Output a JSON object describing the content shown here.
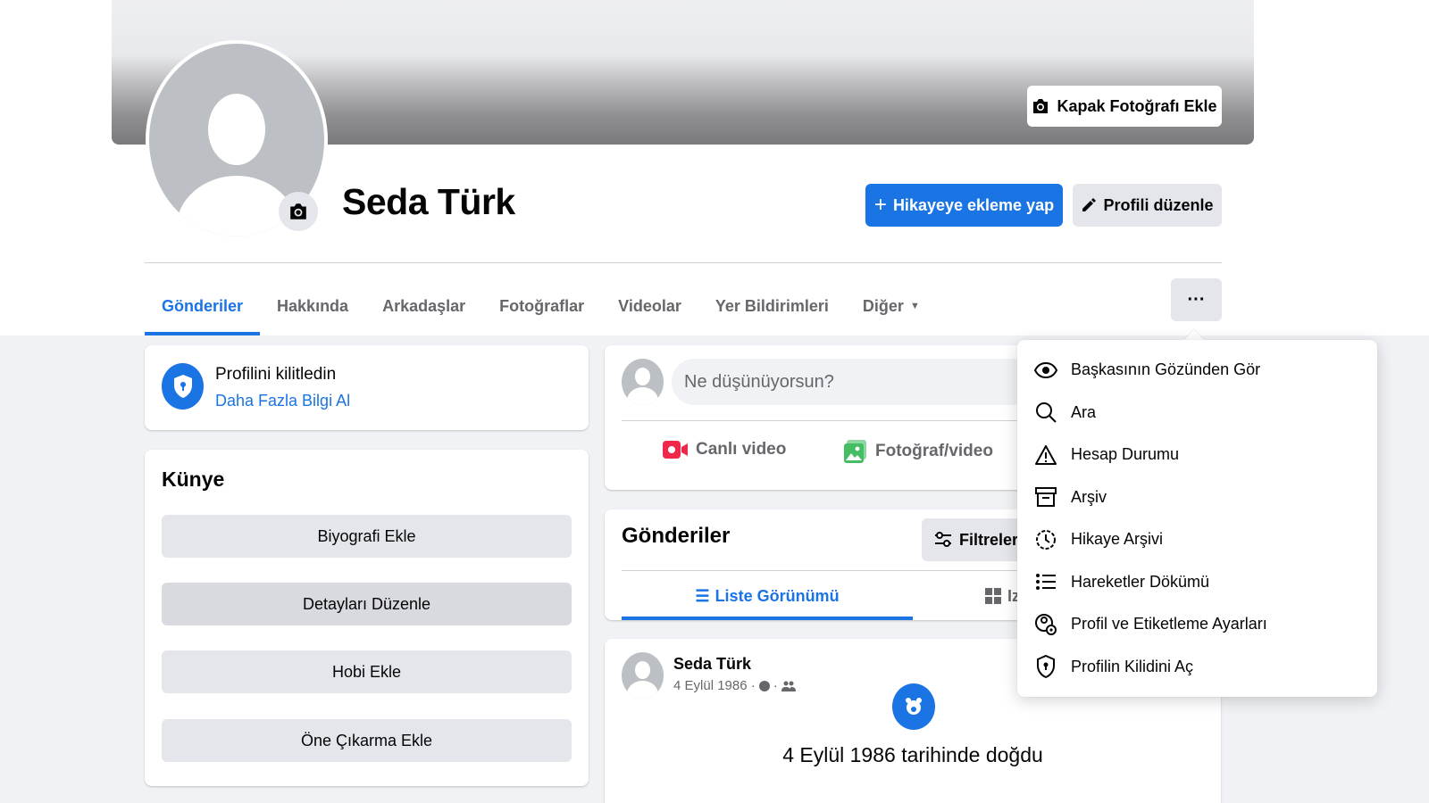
{
  "header": {
    "cover_button_label": "Kapak Fotoğrafı Ekle",
    "profile_name": "Seda Türk",
    "add_story_label": "Hikayeye ekleme yap",
    "edit_profile_label": "Profili düzenle"
  },
  "tabs": [
    {
      "label": "Gönderiler",
      "active": true
    },
    {
      "label": "Hakkında"
    },
    {
      "label": "Arkadaşlar"
    },
    {
      "label": "Fotoğraflar"
    },
    {
      "label": "Videolar"
    },
    {
      "label": "Yer Bildirimleri"
    },
    {
      "label": "Diğer"
    }
  ],
  "more_button_label": "···",
  "lock_card": {
    "title": "Profilini kilitledin",
    "link": "Daha Fazla Bilgi Al"
  },
  "intro": {
    "title": "Künye",
    "buttons": [
      "Biyografi Ekle",
      "Detayları Düzenle",
      "Hobi Ekle",
      "Öne Çıkarma Ekle"
    ]
  },
  "composer": {
    "placeholder": "Ne düşünüyorsun?",
    "live_video": "Canlı video",
    "photo_video": "Fotoğraf/video"
  },
  "posts": {
    "title": "Gönderiler",
    "filters_label": "Filtreler",
    "list_view_label": "Liste Görünümü",
    "grid_view_label": "Iz"
  },
  "post": {
    "author": "Seda Türk",
    "date": "4 Eylül 1986 ·",
    "text": "4 Eylül 1986 tarihinde doğdu"
  },
  "menu": {
    "items": [
      {
        "label": "Başkasının Gözünden Gör",
        "icon": "eye-icon"
      },
      {
        "label": "Ara",
        "icon": "search-icon"
      },
      {
        "label": "Hesap Durumu",
        "icon": "warning-icon"
      },
      {
        "label": "Arşiv",
        "icon": "archive-icon"
      },
      {
        "label": "Hikaye Arşivi",
        "icon": "story-archive-icon"
      },
      {
        "label": "Hareketler Dökümü",
        "icon": "list-icon"
      },
      {
        "label": "Profil ve Etiketleme Ayarları",
        "icon": "profile-settings-icon"
      },
      {
        "label": "Profilin Kilidini Aç",
        "icon": "shield-lock-icon"
      }
    ]
  },
  "colors": {
    "accent": "#1b74e4",
    "secondary_button": "#e4e6eb",
    "page_bg": "#f0f2f5",
    "live_video_red": "#f02849",
    "photo_green": "#45bd62"
  }
}
